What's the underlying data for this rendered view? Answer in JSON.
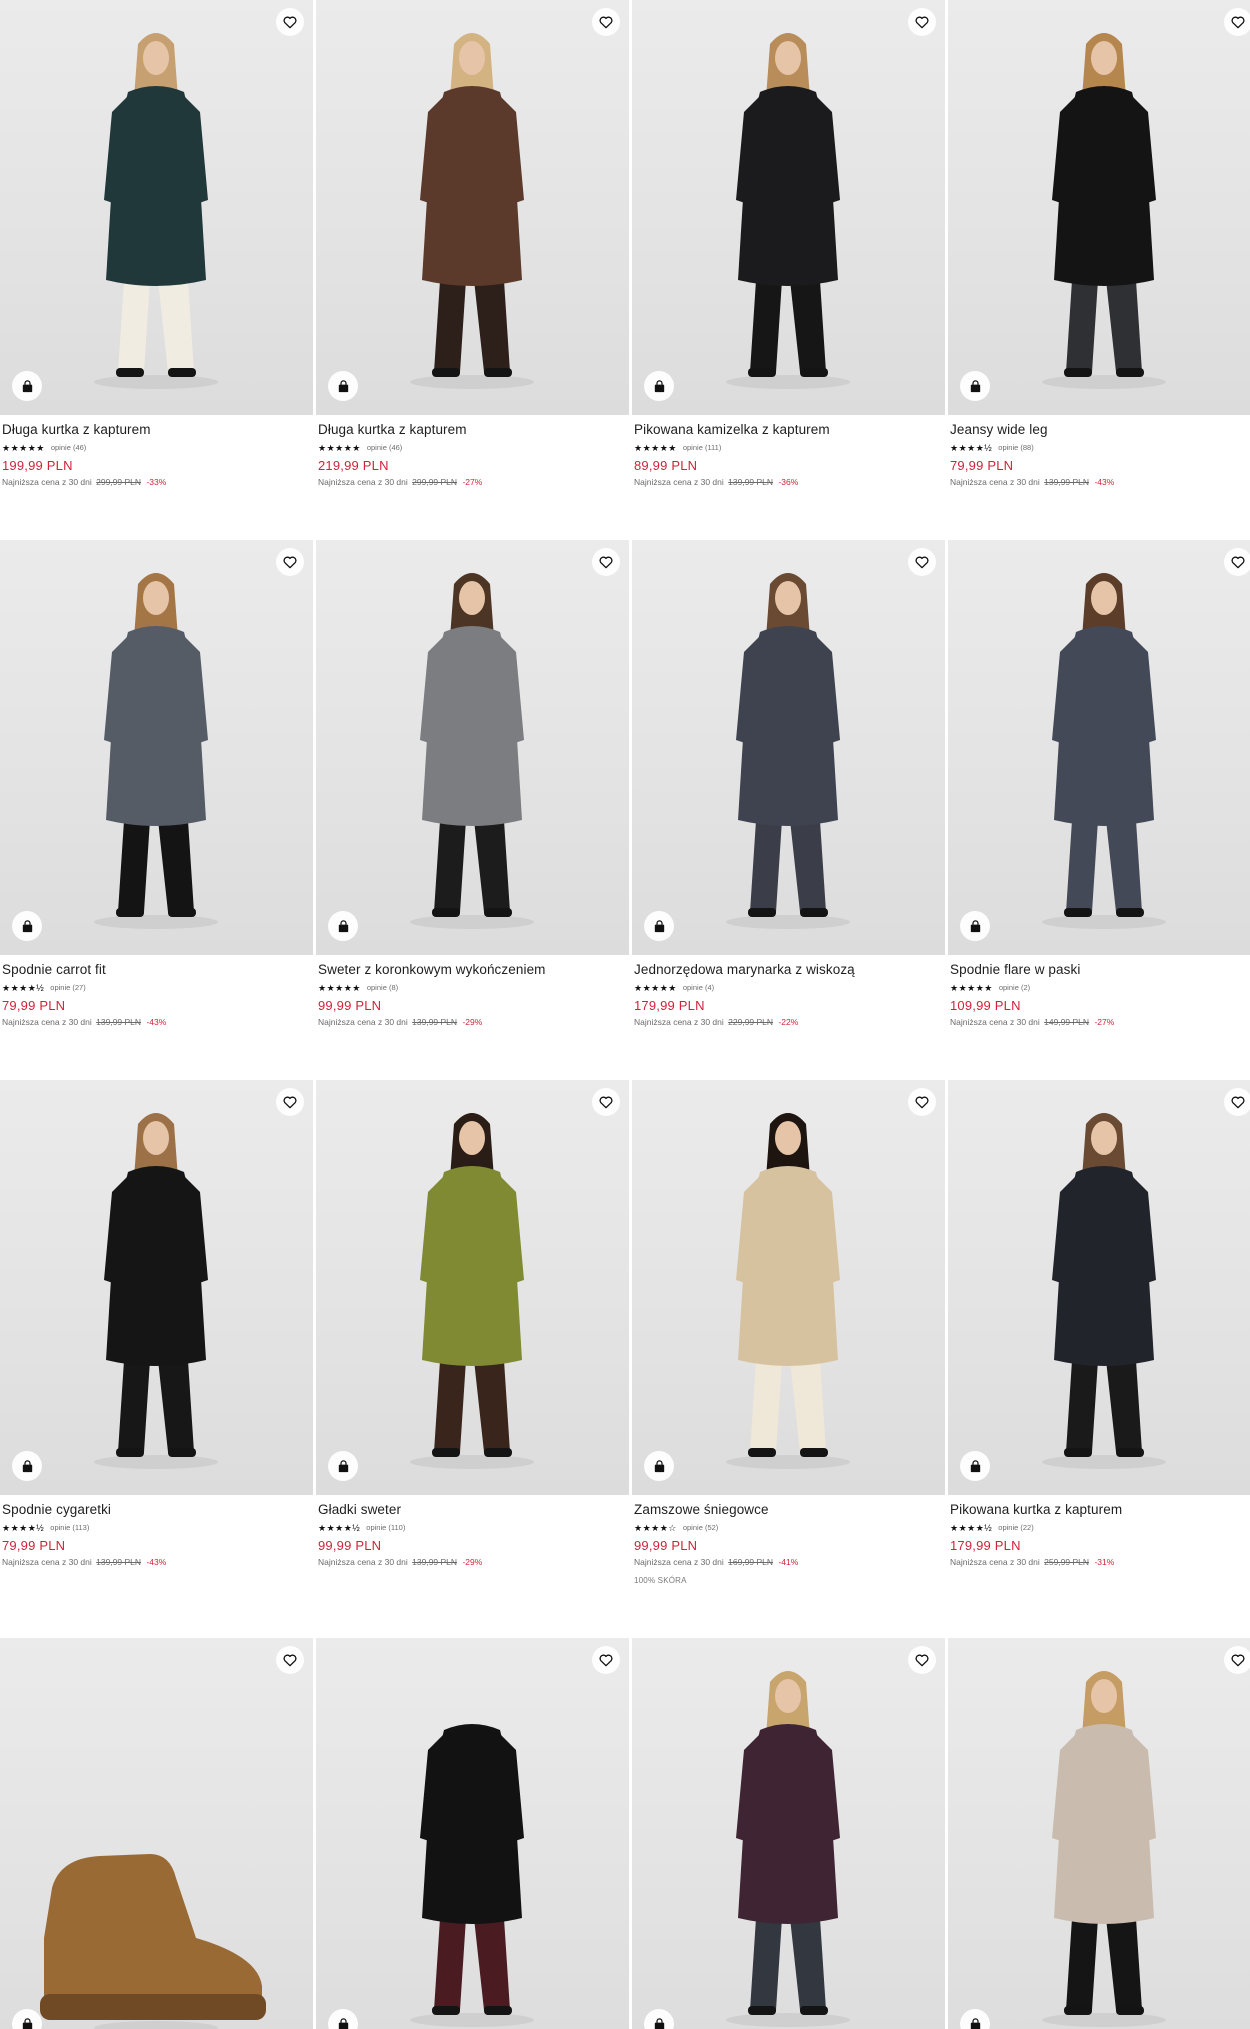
{
  "colors": {
    "price": "#d0233a",
    "discount": "#d0233a",
    "text": "#1e1e1e",
    "muted": "#6a6a6a"
  },
  "icons": {
    "favorite": "heart-icon",
    "cart": "shopping-bag-icon"
  },
  "products": [
    {
      "name": "Długa kurtka z kapturem",
      "stars": "★★★★★",
      "reviews": "opinie (46)",
      "price": "199,99 PLN",
      "lowest_label": "Najniższa cena z 30 dni",
      "old_price": "299,99 PLN",
      "discount": "-33%",
      "extra": "",
      "garment": "#21383a",
      "legs": "#f1ece2",
      "hair": "#c7a072"
    },
    {
      "name": "Długa kurtka z kapturem",
      "stars": "★★★★★",
      "reviews": "opinie (46)",
      "price": "219,99 PLN",
      "lowest_label": "Najniższa cena z 30 dni",
      "old_price": "299,99 PLN",
      "discount": "-27%",
      "extra": "",
      "garment": "#5b3a2c",
      "legs": "#2d1f1a",
      "hair": "#d4b383"
    },
    {
      "name": "Pikowana kamizelka z kapturem",
      "stars": "★★★★★",
      "reviews": "opinie (111)",
      "price": "89,99 PLN",
      "lowest_label": "Najniższa cena z 30 dni",
      "old_price": "139,99 PLN",
      "discount": "-36%",
      "extra": "",
      "garment": "#1b1b1d",
      "legs": "#161616",
      "hair": "#b88d5a"
    },
    {
      "name": "Jeansy wide leg",
      "stars": "★★★★½",
      "reviews": "opinie (88)",
      "price": "79,99 PLN",
      "lowest_label": "Najniższa cena z 30 dni",
      "old_price": "139,99 PLN",
      "discount": "-43%",
      "extra": "",
      "garment": "#141414",
      "legs": "#2f3034",
      "hair": "#b5874f"
    },
    {
      "name": "Spodnie carrot fit",
      "stars": "★★★★½",
      "reviews": "opinie (27)",
      "price": "79,99 PLN",
      "lowest_label": "Najniższa cena z 30 dni",
      "old_price": "139,99 PLN",
      "discount": "-43%",
      "extra": "",
      "garment": "#555c66",
      "legs": "#141414",
      "hair": "#a57645"
    },
    {
      "name": "Sweter z koronkowym wykończeniem",
      "stars": "★★★★★",
      "reviews": "opinie (8)",
      "price": "99,99 PLN",
      "lowest_label": "Najniższa cena z 30 dni",
      "old_price": "139,99 PLN",
      "discount": "-29%",
      "extra": "",
      "garment": "#7b7d80",
      "legs": "#1c1c1c",
      "hair": "#4d3526"
    },
    {
      "name": "Jednorzędowa marynarka z wiskozą",
      "stars": "★★★★★",
      "reviews": "opinie (4)",
      "price": "179,99 PLN",
      "lowest_label": "Najniższa cena z 30 dni",
      "old_price": "229,99 PLN",
      "discount": "-22%",
      "extra": "",
      "garment": "#3f4350",
      "legs": "#3b3e49",
      "hair": "#6a4a32"
    },
    {
      "name": "Spodnie flare w paski",
      "stars": "★★★★★",
      "reviews": "opinie (2)",
      "price": "109,99 PLN",
      "lowest_label": "Najniższa cena z 30 dni",
      "old_price": "149,99 PLN",
      "discount": "-27%",
      "extra": "",
      "garment": "#434956",
      "legs": "#434956",
      "hair": "#5b3d29"
    },
    {
      "name": "Spodnie cygaretki",
      "stars": "★★★★½",
      "reviews": "opinie (113)",
      "price": "79,99 PLN",
      "lowest_label": "Najniższa cena z 30 dni",
      "old_price": "139,99 PLN",
      "discount": "-43%",
      "extra": "",
      "garment": "#151515",
      "legs": "#171717",
      "hair": "#9d7147"
    },
    {
      "name": "Gładki sweter",
      "stars": "★★★★½",
      "reviews": "opinie (110)",
      "price": "99,99 PLN",
      "lowest_label": "Najniższa cena z 30 dni",
      "old_price": "139,99 PLN",
      "discount": "-29%",
      "extra": "",
      "garment": "#7f8a33",
      "legs": "#3a251c",
      "hair": "#2a1d16"
    },
    {
      "name": "Zamszowe śniegowce",
      "stars": "★★★★☆",
      "reviews": "opinie (52)",
      "price": "99,99 PLN",
      "lowest_label": "Najniższa cena z 30 dni",
      "old_price": "169,99 PLN",
      "discount": "-41%",
      "extra": "100% SKÓRA",
      "garment": "#d7c2a0",
      "legs": "#efe8d9",
      "hair": "#1e1410"
    },
    {
      "name": "Pikowana kurtka z kapturem",
      "stars": "★★★★½",
      "reviews": "opinie (22)",
      "price": "179,99 PLN",
      "lowest_label": "Najniższa cena z 30 dni",
      "old_price": "259,99 PLN",
      "discount": "-31%",
      "extra": "",
      "garment": "#22242b",
      "legs": "#1a1a1a",
      "hair": "#6a4a33"
    },
    {
      "name": "",
      "stars": "",
      "reviews": "",
      "price": "",
      "lowest_label": "",
      "old_price": "",
      "discount": "",
      "extra": "",
      "garment": "#9a6a35",
      "legs": "#9a6a35",
      "hair": "#000000"
    },
    {
      "name": "",
      "stars": "",
      "reviews": "",
      "price": "",
      "lowest_label": "",
      "old_price": "",
      "discount": "",
      "extra": "",
      "garment": "#121212",
      "legs": "#4a1c22",
      "hair": "#000000"
    },
    {
      "name": "",
      "stars": "",
      "reviews": "",
      "price": "",
      "lowest_label": "",
      "old_price": "",
      "discount": "",
      "extra": "",
      "garment": "#3f2533",
      "legs": "#33373f",
      "hair": "#c9a56e"
    },
    {
      "name": "",
      "stars": "",
      "reviews": "",
      "price": "",
      "lowest_label": "",
      "old_price": "",
      "discount": "",
      "extra": "",
      "garment": "#c9bcae",
      "legs": "#151515",
      "hair": "#c59c63"
    }
  ]
}
